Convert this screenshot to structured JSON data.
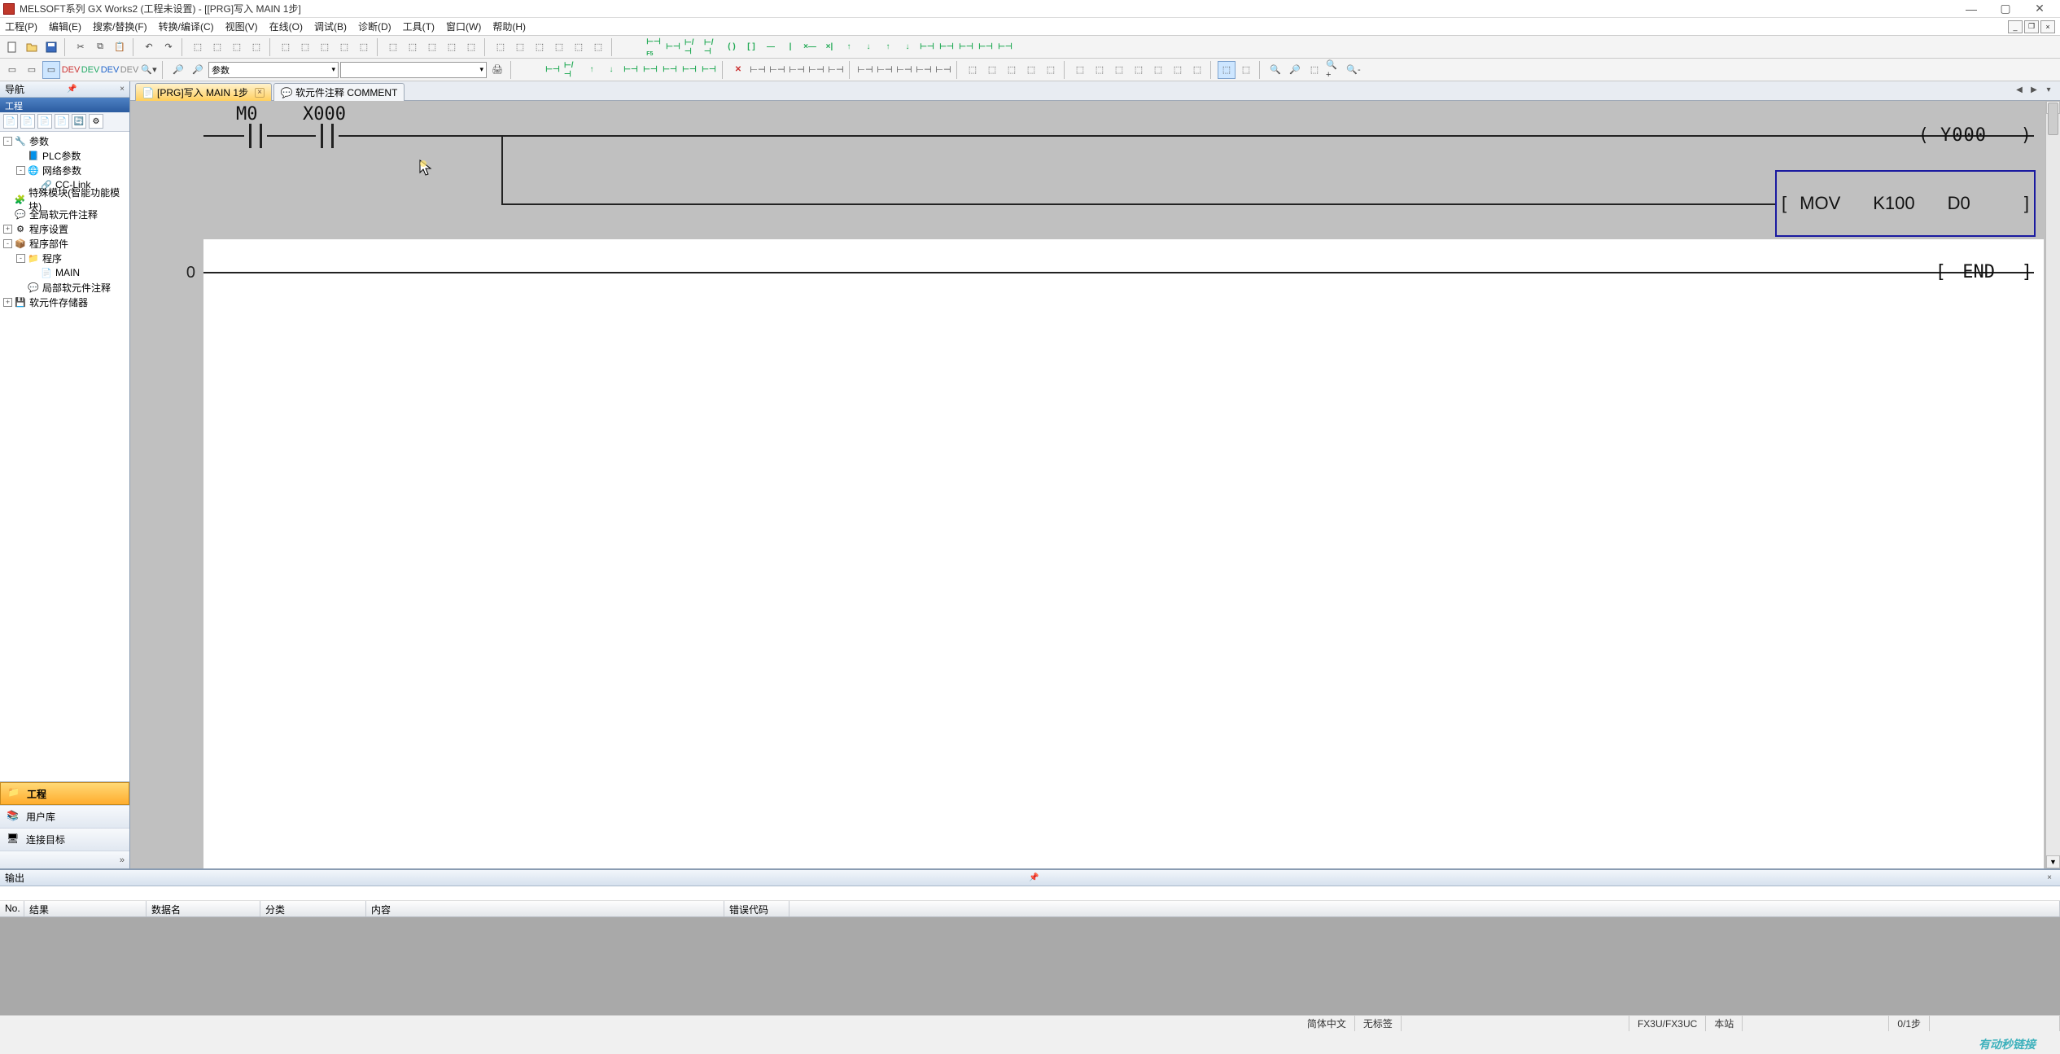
{
  "title": "MELSOFT系列 GX Works2 (工程未设置) - [[PRG]写入 MAIN 1步]",
  "menus": [
    "工程(P)",
    "编辑(E)",
    "搜索/替换(F)",
    "转换/编译(C)",
    "视图(V)",
    "在线(O)",
    "调试(B)",
    "诊断(D)",
    "工具(T)",
    "窗口(W)",
    "帮助(H)"
  ],
  "toolbar2_dd1": "参数",
  "toolbar2_dd2": "",
  "nav": {
    "title": "导航",
    "subtitle": "工程",
    "root_param": "参数",
    "plc_param": "PLC参数",
    "net_param": "网络参数",
    "cclink": "CC-Link",
    "special_mod": "特殊模块(智能功能模块)",
    "global_comment": "全局软元件注释",
    "prog_setting": "程序设置",
    "prog_parts": "程序部件",
    "program": "程序",
    "main_prog": "MAIN",
    "local_comment": "局部软元件注释",
    "device_mem": "软元件存储器",
    "cat_project": "工程",
    "cat_userlib": "用户库",
    "cat_target": "连接目标",
    "strip_sym": "»"
  },
  "tabs": {
    "tab1": "[PRG]写入 MAIN 1步",
    "tab2": "软元件注释 COMMENT"
  },
  "ladder": {
    "step0": "0",
    "m0": "M0",
    "x000": "X000",
    "y000_open": "(",
    "y000": "Y000",
    "y000_close": ")",
    "mov": "MOV",
    "k100": "K100",
    "d0": "D0",
    "lbrk": "[",
    "rbrk": "]",
    "end": "END"
  },
  "output": {
    "title": "输出",
    "col_no": "No.",
    "col_result": "结果",
    "col_dataname": "数据名",
    "col_class": "分类",
    "col_content": "内容",
    "col_errcode": "错误代码"
  },
  "status": {
    "lang": "简体中文",
    "nolabel": "无标签",
    "plc": "FX3U/FX3UC",
    "station": "本站",
    "step": "0/1步"
  },
  "watermark": "有动秒链接"
}
